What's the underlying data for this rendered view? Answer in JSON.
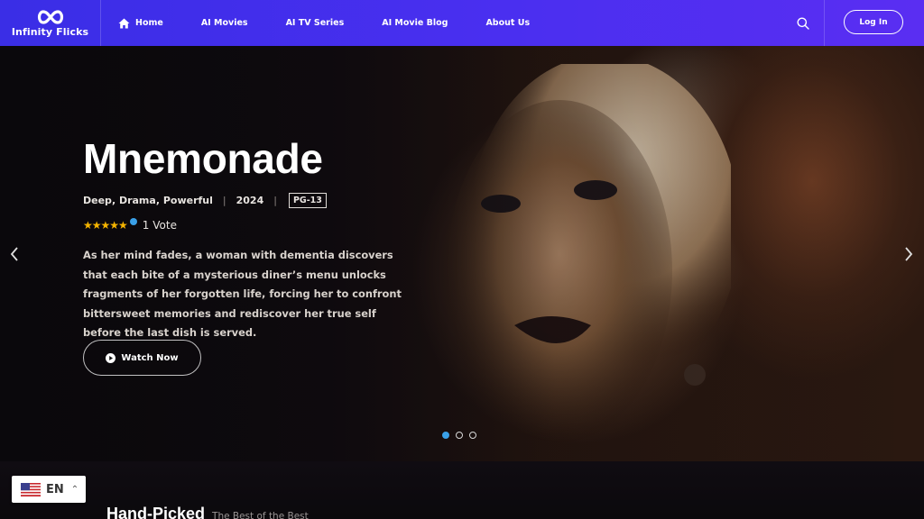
{
  "header": {
    "logo_text": "Infinity Flicks",
    "nav": [
      {
        "label": "Home",
        "icon": "home-icon"
      },
      {
        "label": "AI Movies"
      },
      {
        "label": "AI TV Series"
      },
      {
        "label": "AI Movie Blog"
      },
      {
        "label": "About Us"
      }
    ],
    "search_icon": "search-icon",
    "login_label": "Log In"
  },
  "hero": {
    "title": "Mnemonade",
    "genres": [
      "Deep",
      "Drama",
      "Powerful"
    ],
    "year": "2024",
    "rating_badge": "PG-13",
    "stars": "★★★★★",
    "votes": "1 Vote",
    "description": "As her mind fades, a woman with dementia discovers that each bite of a mysterious diner’s menu unlocks fragments of her forgotten life, forcing her to confront bittersweet memories and rediscover her true self before the last dish is served.",
    "watch_label": "Watch Now",
    "slides": 3,
    "active_slide": 1
  },
  "section": {
    "title": "Hand-Picked",
    "subtitle": "The Best of the Best"
  },
  "language": {
    "code": "EN",
    "flag": "us-flag-icon"
  },
  "colors": {
    "header_start": "#3a2ee6",
    "header_end": "#5a2ef2",
    "accent": "#3aa0e8",
    "star": "#f5b400"
  }
}
